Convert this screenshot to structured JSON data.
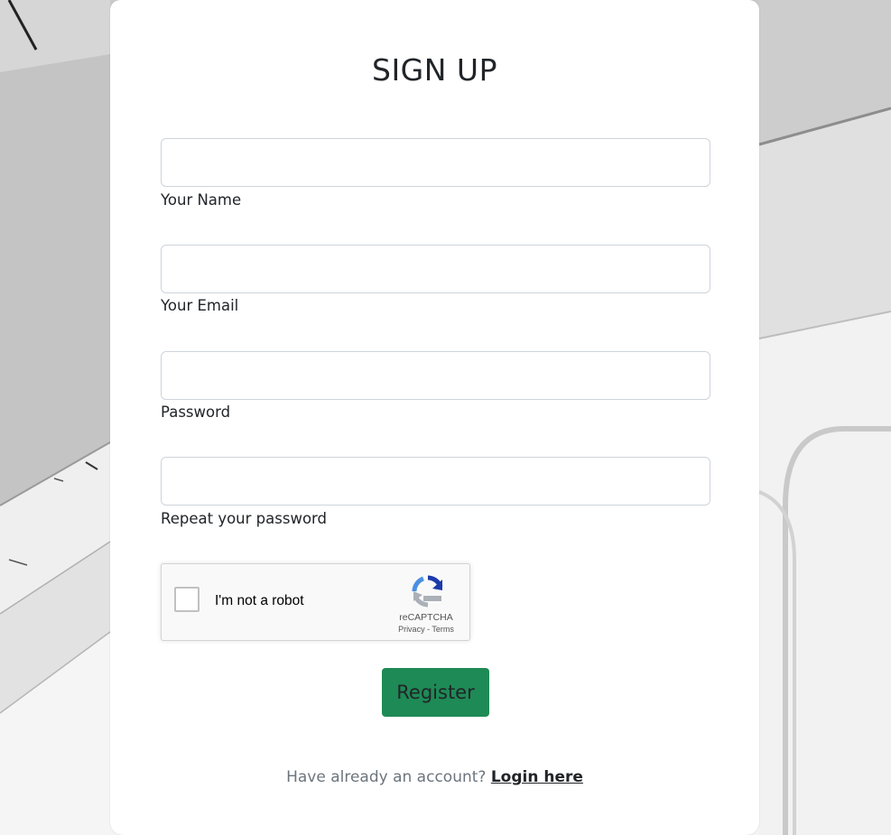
{
  "form": {
    "title": "SIGN UP",
    "fields": [
      {
        "label": "Your Name",
        "value": "",
        "placeholder": ""
      },
      {
        "label": "Your Email",
        "value": "",
        "placeholder": ""
      },
      {
        "label": "Password",
        "value": "",
        "placeholder": ""
      },
      {
        "label": "Repeat your password",
        "value": "",
        "placeholder": ""
      }
    ],
    "recaptcha": {
      "label": "I'm not a robot",
      "brand": "reCAPTCHA",
      "privacy": "Privacy",
      "separator": " - ",
      "terms": "Terms",
      "checked": false
    },
    "register_label": "Register",
    "login_prompt": "Have already an account?",
    "login_link": "Login here"
  },
  "colors": {
    "button_green": "#1e8a55",
    "recaptcha_blue": "#1c3aa9",
    "recaptcha_light_blue": "#4a90e2",
    "recaptcha_grey": "#abb0b8"
  },
  "icons": {
    "recaptcha_logo": "recaptcha-logo-icon",
    "checkbox": "checkbox-icon"
  }
}
